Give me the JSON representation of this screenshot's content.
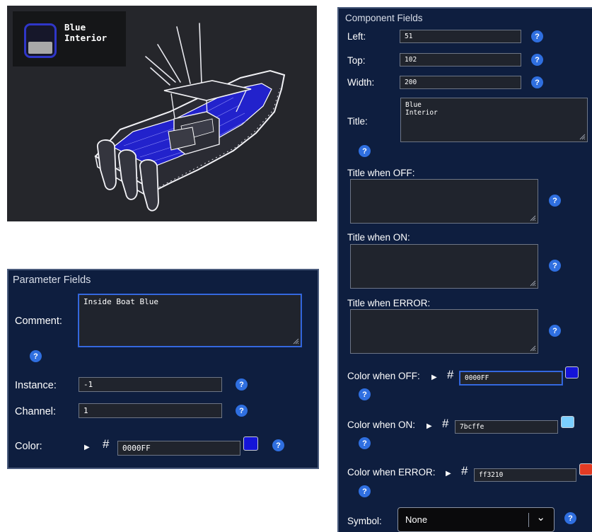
{
  "preview": {
    "button_title": "Blue\nInterior"
  },
  "parameter_fields": {
    "heading": "Parameter Fields",
    "comment_label": "Comment:",
    "comment_value": "Inside Boat Blue",
    "instance_label": "Instance:",
    "instance_value": "-1",
    "channel_label": "Channel:",
    "channel_value": "1",
    "color_label": "Color:",
    "color_value": "0000FF",
    "color_swatch": "#1414d8"
  },
  "component_fields": {
    "heading": "Component Fields",
    "left_label": "Left:",
    "left_value": "51",
    "top_label": "Top:",
    "top_value": "102",
    "width_label": "Width:",
    "width_value": "200",
    "title_label": "Title:",
    "title_value": "Blue\nInterior",
    "title_off_label": "Title when OFF:",
    "title_off_value": "",
    "title_on_label": "Title when ON:",
    "title_on_value": "",
    "title_error_label": "Title when ERROR:",
    "title_error_value": "",
    "color_off_label": "Color when OFF:",
    "color_off_value": "0000FF",
    "color_off_swatch": "#1414d8",
    "color_on_label": "Color when ON:",
    "color_on_value": "7bcffe",
    "color_on_swatch": "#7bcffe",
    "color_error_label": "Color when ERROR:",
    "color_error_value": "ff3210",
    "color_error_swatch": "#e23b24",
    "symbol_label": "Symbol:",
    "symbol_value": "None"
  },
  "common": {
    "help_glyph": "?",
    "hash_glyph": "#",
    "play_glyph": "▶",
    "dropdown_glyph": "⌄"
  },
  "colors": {
    "panel_bg": "#0e1e3f",
    "help_blue": "#2f6fe0",
    "boat_interior": "#2222cc"
  }
}
